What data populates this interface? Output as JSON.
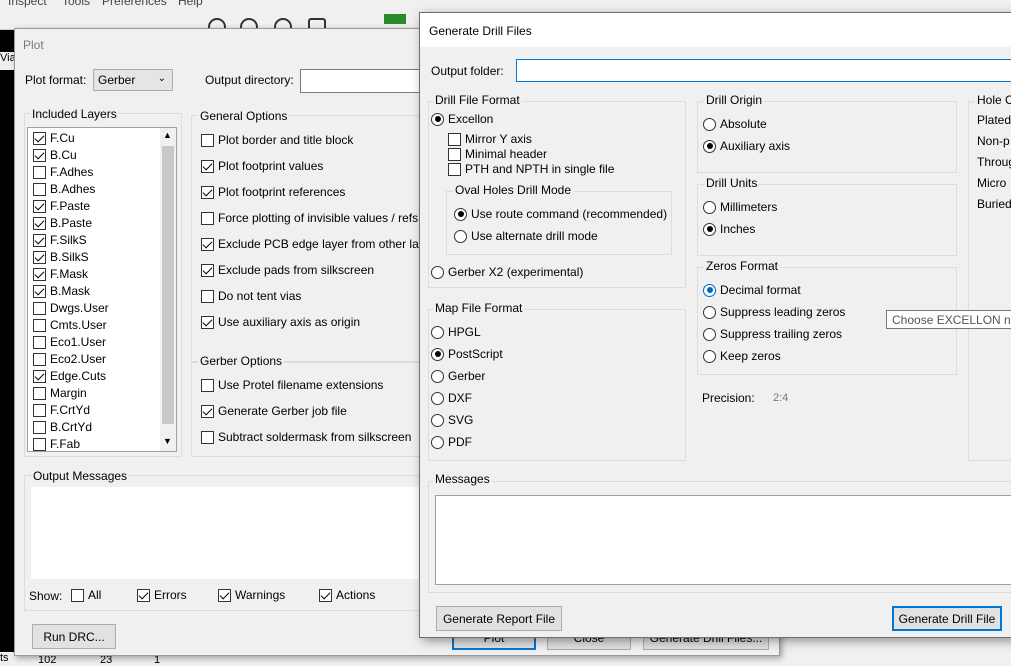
{
  "background": {
    "menu": [
      "Inspect",
      "Tools",
      "Preferences",
      "Help"
    ],
    "side_tab": "Via",
    "bottom_left": "ts",
    "bottom_values": [
      "102",
      "23",
      "1"
    ]
  },
  "plot": {
    "title": "Plot",
    "plot_format_label": "Plot format:",
    "plot_format_value": "Gerber",
    "output_dir_label": "Output directory:",
    "included_layers_title": "Included Layers",
    "layers": [
      {
        "name": "F.Cu",
        "checked": true
      },
      {
        "name": "B.Cu",
        "checked": true
      },
      {
        "name": "F.Adhes",
        "checked": false
      },
      {
        "name": "B.Adhes",
        "checked": false
      },
      {
        "name": "F.Paste",
        "checked": true
      },
      {
        "name": "B.Paste",
        "checked": true
      },
      {
        "name": "F.SilkS",
        "checked": true
      },
      {
        "name": "B.SilkS",
        "checked": true
      },
      {
        "name": "F.Mask",
        "checked": true
      },
      {
        "name": "B.Mask",
        "checked": true
      },
      {
        "name": "Dwgs.User",
        "checked": false
      },
      {
        "name": "Cmts.User",
        "checked": false
      },
      {
        "name": "Eco1.User",
        "checked": false
      },
      {
        "name": "Eco2.User",
        "checked": false
      },
      {
        "name": "Edge.Cuts",
        "checked": true
      },
      {
        "name": "Margin",
        "checked": false
      },
      {
        "name": "F.CrtYd",
        "checked": false
      },
      {
        "name": "B.CrtYd",
        "checked": false
      },
      {
        "name": "F.Fab",
        "checked": false
      }
    ],
    "general_options_title": "General Options",
    "general_options": [
      {
        "label": "Plot border and title block",
        "checked": false
      },
      {
        "label": "Plot footprint values",
        "checked": true
      },
      {
        "label": "Plot footprint references",
        "checked": true
      },
      {
        "label": "Force plotting of invisible values / refs",
        "checked": false
      },
      {
        "label": "Exclude PCB edge layer from other layers",
        "checked": true
      },
      {
        "label": "Exclude pads from silkscreen",
        "checked": true
      },
      {
        "label": "Do not tent vias",
        "checked": false
      },
      {
        "label": "Use auxiliary axis as origin",
        "checked": true
      }
    ],
    "gerber_options_title": "Gerber Options",
    "gerber_options": [
      {
        "label": "Use Protel filename extensions",
        "checked": false
      },
      {
        "label": "Generate Gerber job file",
        "checked": true
      },
      {
        "label": "Subtract soldermask from silkscreen",
        "checked": false
      }
    ],
    "output_messages_title": "Output Messages",
    "show_label": "Show:",
    "show_filters": [
      {
        "label": "All",
        "checked": false
      },
      {
        "label": "Errors",
        "checked": true
      },
      {
        "label": "Warnings",
        "checked": true
      },
      {
        "label": "Actions",
        "checked": true
      }
    ],
    "run_drc": "Run DRC...",
    "plot_button": "Plot",
    "close_button": "Close",
    "gen_drill_button": "Generate Drill Files..."
  },
  "drill": {
    "title": "Generate Drill Files",
    "output_folder_label": "Output folder:",
    "output_folder_value": "",
    "drill_format_title": "Drill File Format",
    "excellon_label": "Excellon",
    "excellon_checked": true,
    "excellon_options": [
      {
        "label": "Mirror Y axis",
        "checked": false
      },
      {
        "label": "Minimal header",
        "checked": false
      },
      {
        "label": "PTH and NPTH in single file",
        "checked": false
      }
    ],
    "oval_title": "Oval Holes Drill Mode",
    "oval_options": [
      {
        "label": "Use route command (recommended)",
        "checked": true
      },
      {
        "label": "Use alternate drill mode",
        "checked": false
      }
    ],
    "gerber_x2_label": "Gerber X2 (experimental)",
    "map_format_title": "Map File Format",
    "map_formats": [
      {
        "label": "HPGL",
        "checked": false
      },
      {
        "label": "PostScript",
        "checked": true
      },
      {
        "label": "Gerber",
        "checked": false
      },
      {
        "label": "DXF",
        "checked": false
      },
      {
        "label": "SVG",
        "checked": false
      },
      {
        "label": "PDF",
        "checked": false
      }
    ],
    "drill_origin_title": "Drill Origin",
    "drill_origin": [
      {
        "label": "Absolute",
        "checked": false
      },
      {
        "label": "Auxiliary axis",
        "checked": true
      }
    ],
    "drill_units_title": "Drill Units",
    "drill_units": [
      {
        "label": "Millimeters",
        "checked": false
      },
      {
        "label": "Inches",
        "checked": true
      }
    ],
    "zeros_title": "Zeros Format",
    "zeros": [
      {
        "label": "Decimal format",
        "checked": true
      },
      {
        "label": "Suppress leading zeros",
        "checked": false
      },
      {
        "label": "Suppress trailing zeros",
        "checked": false
      },
      {
        "label": "Keep zeros",
        "checked": false
      }
    ],
    "precision_label": "Precision:",
    "precision_value": "2:4",
    "hole_count_title": "Hole C",
    "hole_count_rows": [
      "Plated",
      "Non-p",
      "Throug",
      "Micro",
      "Buried"
    ],
    "messages_title": "Messages",
    "report_button": "Generate Report File",
    "drill_button": "Generate Drill File"
  },
  "tooltip": "Choose EXCELLON numbers notation",
  "colors": {
    "accent": "#0078d7",
    "radio_blue": "#0067c0"
  }
}
